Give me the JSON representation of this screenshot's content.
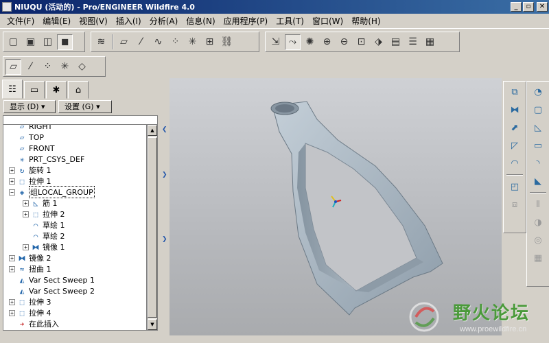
{
  "window": {
    "title": "NIUQU (活动的) - Pro/ENGINEER Wildfire 4.0",
    "minimize": "_",
    "maximize": "▫",
    "close": "✕"
  },
  "menu": [
    "文件(F)",
    "编辑(E)",
    "视图(V)",
    "插入(I)",
    "分析(A)",
    "信息(N)",
    "应用程序(P)",
    "工具(T)",
    "窗口(W)",
    "帮助(H)"
  ],
  "panel": {
    "show_label": "显示 (D) ▾",
    "settings_label": "设置 (G) ▾",
    "tree_items": [
      {
        "label": "RIGHT",
        "icon": "datum-plane-icon",
        "expand": ""
      },
      {
        "label": "TOP",
        "icon": "datum-plane-icon",
        "expand": ""
      },
      {
        "label": "FRONT",
        "icon": "datum-plane-icon",
        "expand": ""
      },
      {
        "label": "PRT_CSYS_DEF",
        "icon": "csys-icon",
        "expand": ""
      },
      {
        "label": "旋转 1",
        "icon": "revolve-icon",
        "expand": "+"
      },
      {
        "label": "拉伸 1",
        "icon": "extrude-icon",
        "expand": "+"
      },
      {
        "label": "组LOCAL_GROUP",
        "icon": "group-icon",
        "expand": "−"
      },
      {
        "label": "筋 1",
        "icon": "rib-icon",
        "expand": "+",
        "indent": 1
      },
      {
        "label": "拉伸 2",
        "icon": "extrude-icon",
        "expand": "+",
        "indent": 1
      },
      {
        "label": "草绘 1",
        "icon": "sketch-icon",
        "expand": "",
        "indent": 1
      },
      {
        "label": "草绘 2",
        "icon": "sketch-icon",
        "expand": "",
        "indent": 1
      },
      {
        "label": "镜像 1",
        "icon": "mirror-icon",
        "expand": "+",
        "indent": 1
      },
      {
        "label": "镜像 2",
        "icon": "mirror-icon",
        "expand": "+"
      },
      {
        "label": "扭曲 1",
        "icon": "warp-icon",
        "expand": "+"
      },
      {
        "label": "Var Sect Sweep 1",
        "icon": "sweep-icon",
        "expand": ""
      },
      {
        "label": "Var Sect Sweep 2",
        "icon": "sweep-icon",
        "expand": ""
      },
      {
        "label": "拉伸 3",
        "icon": "extrude-icon",
        "expand": "+"
      },
      {
        "label": "拉伸 4",
        "icon": "extrude-icon",
        "expand": "+"
      },
      {
        "label": "在此插入",
        "icon": "insert-here-icon",
        "expand": ""
      }
    ]
  },
  "watermark": {
    "text": "野火论坛",
    "url": "www.proewildfire.cn"
  },
  "colors": {
    "title_start": "#0a246a",
    "title_end": "#3a6ea5",
    "chrome": "#d4d0c8",
    "model": "#9fb0bf",
    "watermark_green": "#4a9a3a"
  }
}
